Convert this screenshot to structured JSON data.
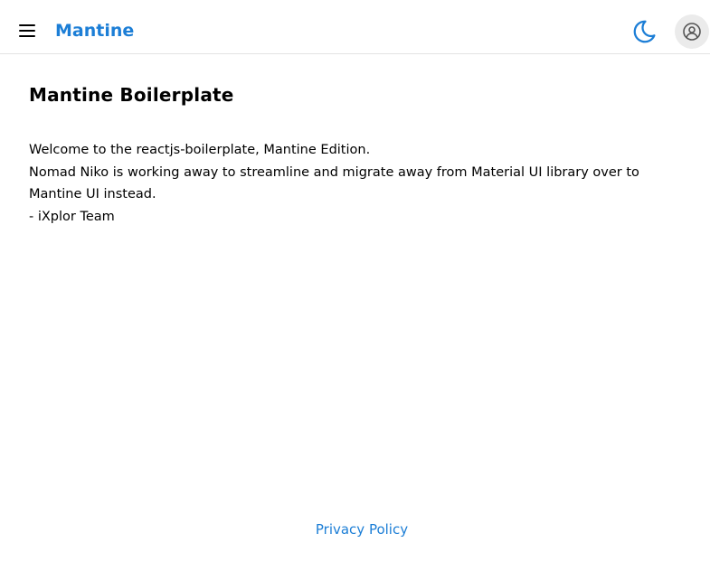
{
  "header": {
    "menu_icon": "hamburger-menu-icon",
    "brand": "Mantine",
    "theme_icon": "moon-icon",
    "account_icon": "user-circle-icon",
    "accent_color": "#1c7ed6"
  },
  "main": {
    "title": "Mantine Boilerplate",
    "lines": [
      "Welcome to the reactjs-boilerplate, Mantine Edition.",
      "Nomad Niko is working away to streamline and migrate away from Material UI library over to Mantine UI instead.",
      "- iXplor Team"
    ]
  },
  "footer": {
    "privacy_link": "Privacy Policy"
  }
}
